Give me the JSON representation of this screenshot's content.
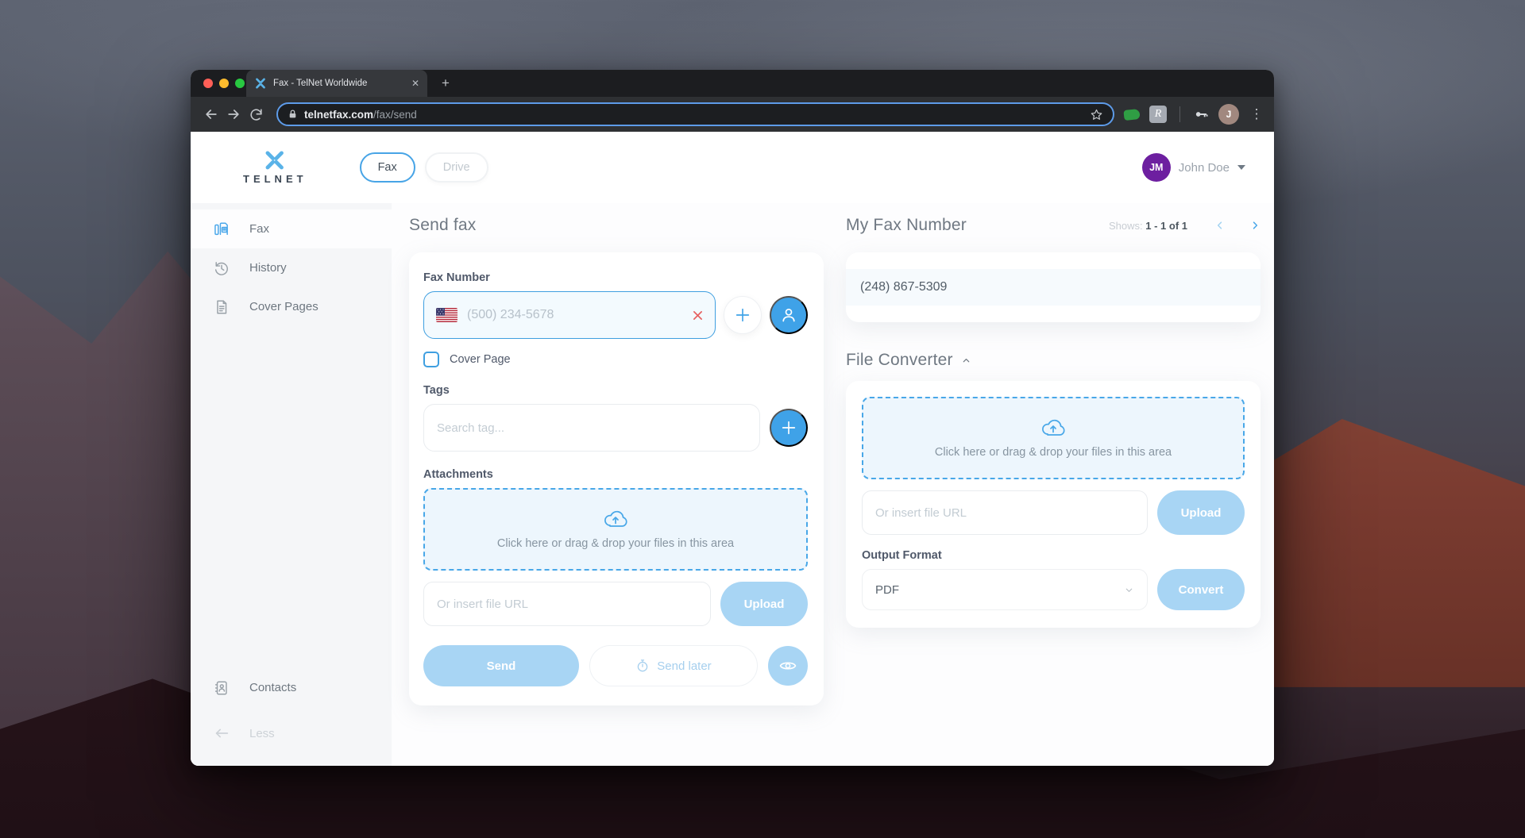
{
  "browser": {
    "tab_title": "Fax - TelNet Worldwide",
    "url_domain": "telnetfax.com",
    "url_path": "/fax/send",
    "profile_initial": "J"
  },
  "header": {
    "brand": "TELNET",
    "nav": [
      {
        "label": "Fax",
        "active": true
      },
      {
        "label": "Drive",
        "active": false
      }
    ],
    "user_initials": "JM",
    "user_name": "John Doe"
  },
  "sidebar": {
    "items": [
      {
        "label": "Fax",
        "active": true
      },
      {
        "label": "History",
        "active": false
      },
      {
        "label": "Cover Pages",
        "active": false
      },
      {
        "label": "Contacts",
        "active": false
      }
    ],
    "collapse_label": "Less"
  },
  "send_fax": {
    "title": "Send fax",
    "fax_number_label": "Fax Number",
    "fax_number_placeholder": "(500) 234-5678",
    "cover_page_label": "Cover Page",
    "tags_label": "Tags",
    "tags_placeholder": "Search tag...",
    "attachments_label": "Attachments",
    "dropzone_text": "Click here or drag & drop your files in this area",
    "url_placeholder": "Or insert file URL",
    "upload_label": "Upload",
    "send_label": "Send",
    "send_later_label": "Send later"
  },
  "my_fax_number": {
    "title": "My Fax Number",
    "shows_label": "Shows:",
    "shows_value": "1 - 1 of 1",
    "number": "(248) 867-5309"
  },
  "file_converter": {
    "title": "File Converter",
    "dropzone_text": "Click here or drag & drop your files in this area",
    "url_placeholder": "Or insert file URL",
    "upload_label": "Upload",
    "output_format_label": "Output Format",
    "output_format_value": "PDF",
    "convert_label": "Convert"
  },
  "colors": {
    "accent": "#3fa2e8",
    "accent_light": "#a8d5f4",
    "user_avatar_purple": "#6d1fa0",
    "danger": "#e66060"
  }
}
